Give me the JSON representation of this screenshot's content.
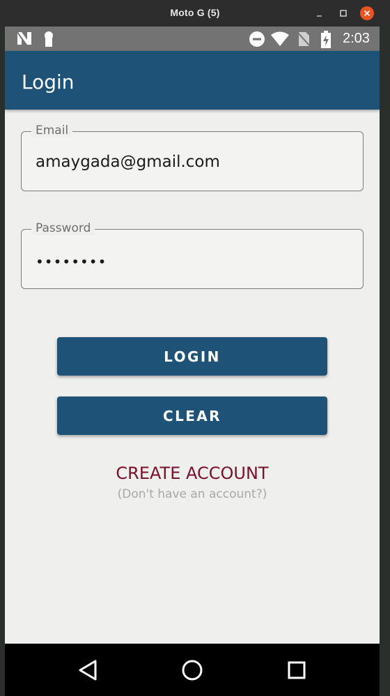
{
  "window": {
    "title": "Moto G (5)",
    "buttons": {
      "minimize": "minimize-icon",
      "maximize": "maximize-icon",
      "close": "close-icon"
    }
  },
  "status_bar": {
    "left_icons": [
      "n-notification-icon",
      "keyhole-notification-icon"
    ],
    "right_icons": [
      "do-not-disturb-icon",
      "wifi-icon",
      "no-sim-icon",
      "battery-charging-icon"
    ],
    "time": "2:03"
  },
  "app_bar": {
    "title": "Login",
    "color": "#1e5276"
  },
  "form": {
    "email": {
      "label": "Email",
      "value": "amaygada@gmail.com"
    },
    "password": {
      "label": "Password",
      "masked_value": "••••••••"
    }
  },
  "buttons": {
    "login_label": "LOGIN",
    "clear_label": "CLEAR"
  },
  "create_account": {
    "link": "CREATE ACCOUNT",
    "hint": "(Don't have an account?)",
    "color": "#7a0f2e"
  },
  "nav_bar": {
    "icons": [
      "back-icon",
      "home-icon",
      "recents-icon"
    ]
  }
}
